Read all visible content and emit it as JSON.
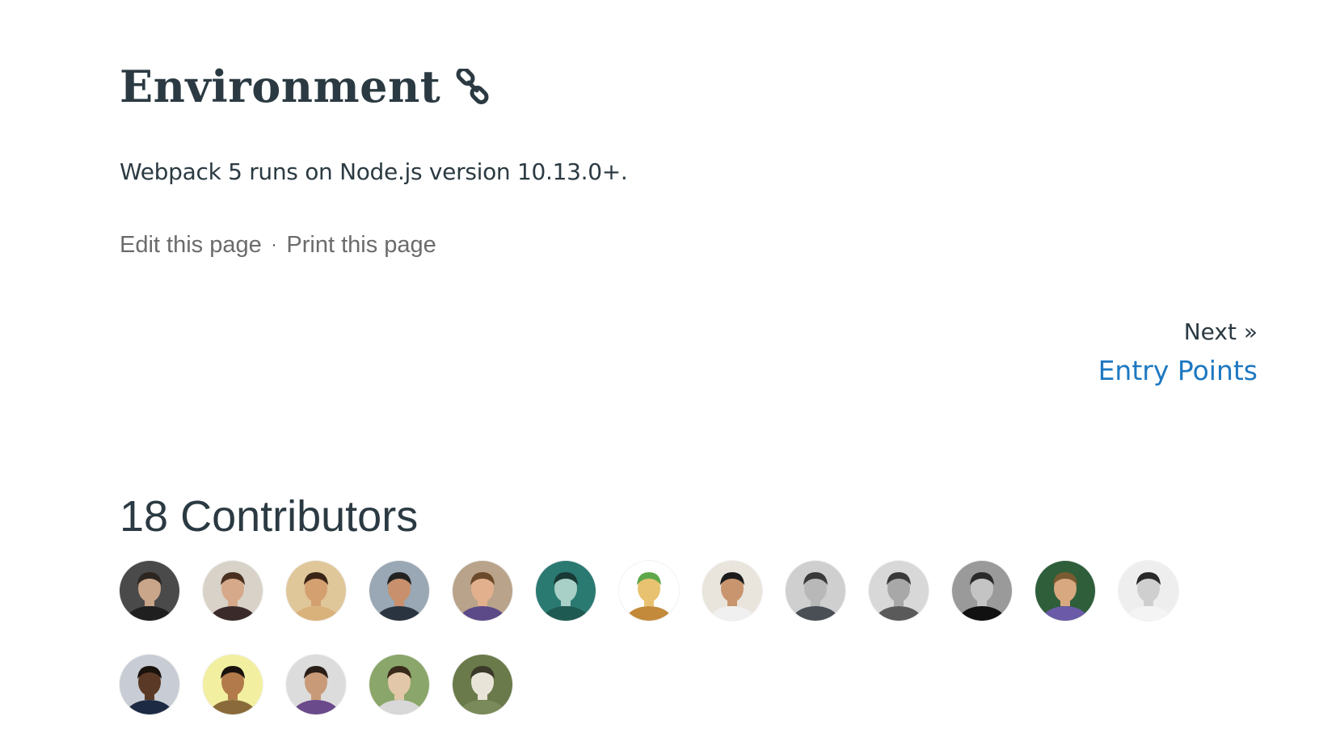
{
  "section": {
    "title": "Environment",
    "anchor_icon": "link-icon",
    "description": "Webpack 5 runs on Node.js version 10.13.0+."
  },
  "page_actions": {
    "edit_label": "Edit this page",
    "separator": "·",
    "print_label": "Print this page"
  },
  "pager": {
    "next_label": "Next »",
    "next_page": "Entry Points"
  },
  "contributors": {
    "heading": "18 Contributors",
    "count": 18,
    "rows": [
      [
        {
          "bg": "#4a4a4a",
          "skin": "#c9a58a",
          "hair": "#2d2520",
          "shirt": "#1f1f1f"
        },
        {
          "bg": "#d9d2c8",
          "skin": "#d6a98a",
          "hair": "#4a3020",
          "shirt": "#3b2a2a"
        },
        {
          "bg": "#e0c79a",
          "skin": "#d4a070",
          "hair": "#3a2415",
          "shirt": "#d8b27a"
        },
        {
          "bg": "#9aa7b4",
          "skin": "#c8906c",
          "hair": "#222222",
          "shirt": "#2a3440"
        },
        {
          "bg": "#b9a38a",
          "skin": "#e3b08d",
          "hair": "#6a4a2a",
          "shirt": "#5c4a88"
        },
        {
          "bg": "#2a7a72",
          "skin": "#a9d0c6",
          "hair": "#1a3a36",
          "shirt": "#1f5a52"
        },
        {
          "bg": "#ffffff",
          "skin": "#e8c270",
          "hair": "#5fa84a",
          "shirt": "#c28a3a"
        },
        {
          "bg": "#e9e4dc",
          "skin": "#c9956e",
          "hair": "#1c1c1c",
          "shirt": "#f0f0f0"
        },
        {
          "bg": "#cfcfcf",
          "skin": "#b8b8b8",
          "hair": "#3a3a3a",
          "shirt": "#4a4f55"
        },
        {
          "bg": "#d8d8d8",
          "skin": "#a8a8a8",
          "hair": "#3a3a3a",
          "shirt": "#5a5a5a"
        },
        {
          "bg": "#9a9a9a",
          "skin": "#c4c4c4",
          "hair": "#2a2a2a",
          "shirt": "#111111"
        },
        {
          "bg": "#2e5e3a",
          "skin": "#d8a880",
          "hair": "#7a5a30",
          "shirt": "#6a5aa8"
        },
        {
          "bg": "#eeeeee",
          "skin": "#cfcfcf",
          "hair": "#2a2a2a",
          "shirt": "#f4f4f4"
        }
      ],
      [
        {
          "bg": "#c8ccd4",
          "skin": "#5a3a26",
          "hair": "#1a120c",
          "shirt": "#1c2a44"
        },
        {
          "bg": "#f2f0a0",
          "skin": "#b27a4a",
          "hair": "#1a120c",
          "shirt": "#8a6a3a"
        },
        {
          "bg": "#dcdcdc",
          "skin": "#c89a78",
          "hair": "#2a1e18",
          "shirt": "#6a4a8a"
        },
        {
          "bg": "#8aa66a",
          "skin": "#e2c8a8",
          "hair": "#3a2a1a",
          "shirt": "#d8d8d8"
        },
        {
          "bg": "#6a7a4a",
          "skin": "#e8e4d8",
          "hair": "#3a3a2a",
          "shirt": "#7a8a5a"
        }
      ]
    ]
  }
}
